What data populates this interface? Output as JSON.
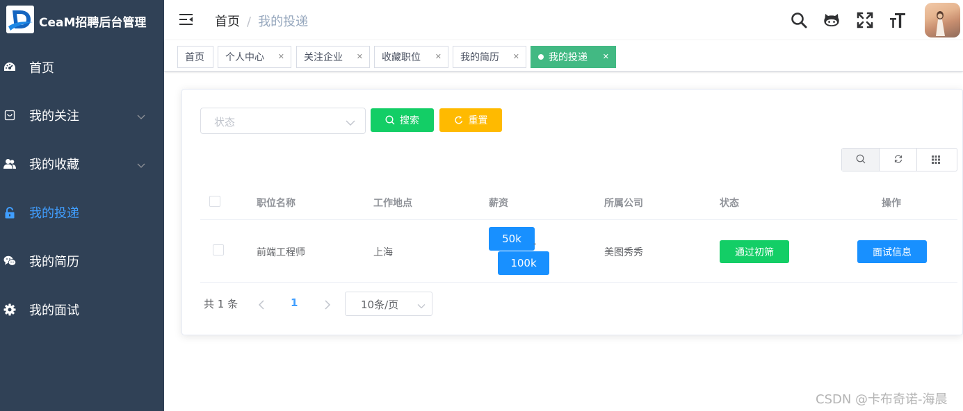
{
  "app": {
    "title": "CeaM招聘后台管理"
  },
  "sidebar": {
    "items": [
      {
        "label": "首页",
        "icon": "dashboard-icon"
      },
      {
        "label": "我的关注",
        "icon": "shopping-bag-icon"
      },
      {
        "label": "我的收藏",
        "icon": "users-icon"
      },
      {
        "label": "我的投递",
        "icon": "lock-icon",
        "active": true
      },
      {
        "label": "我的简历",
        "icon": "wechat-icon"
      },
      {
        "label": "我的面试",
        "icon": "gear-icon"
      }
    ]
  },
  "header": {
    "breadcrumb": [
      "首页",
      "我的投递"
    ]
  },
  "tags": [
    {
      "label": "首页"
    },
    {
      "label": "个人中心"
    },
    {
      "label": "关注企业"
    },
    {
      "label": "收藏职位"
    },
    {
      "label": "我的简历"
    },
    {
      "label": "我的投递",
      "active": true
    }
  ],
  "filter": {
    "status_placeholder": "状态",
    "search_label": "搜索",
    "reset_label": "重置"
  },
  "table": {
    "columns": [
      "职位名称",
      "工作地点",
      "薪资",
      "所属公司",
      "状态",
      "操作"
    ],
    "rows": [
      {
        "title": "前端工程师",
        "location": "上海",
        "salary_min": "50k",
        "salary_sep": "-",
        "salary_max": "100k",
        "company": "美图秀秀",
        "status": "通过初筛",
        "action": "面试信息"
      }
    ]
  },
  "pagination": {
    "total_text": "共 1 条",
    "current_page": "1",
    "page_size": "10条/页"
  },
  "watermark": "CSDN @卡布奇诺-海晨",
  "colors": {
    "sidebar_bg": "#304156",
    "active_menu": "#409EFF",
    "active_tag": "#42b983",
    "success": "#13ce66",
    "warning": "#ffba00",
    "primary": "#1890ff"
  }
}
